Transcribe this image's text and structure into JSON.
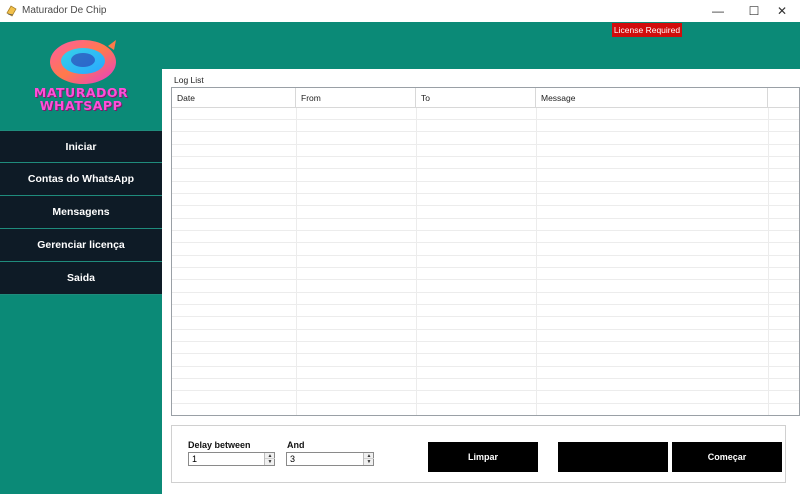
{
  "window": {
    "title": "Maturador De Chip",
    "minimize_glyph": "—",
    "maximize_glyph": "☐",
    "close_glyph": "✕"
  },
  "sidebar": {
    "logo_line1": "MATURADOR",
    "logo_line2": "WHATSAPP",
    "items": [
      {
        "label": "Iniciar"
      },
      {
        "label": "Contas do WhatsApp"
      },
      {
        "label": "Mensagens"
      },
      {
        "label": "Gerenciar licença"
      },
      {
        "label": "Saida"
      }
    ]
  },
  "header": {
    "license_badge": "License Required"
  },
  "log": {
    "label": "Log List",
    "columns": [
      "Date",
      "From",
      "To",
      "Message"
    ],
    "rows": []
  },
  "controls": {
    "delay_label": "Delay between",
    "delay_value": "1",
    "and_label": "And",
    "and_value": "3",
    "clear_button": "Limpar",
    "blank_button": "",
    "start_button": "Começar"
  },
  "colors": {
    "accent_teal": "#0b8a77",
    "nav_dark": "#0e1b26",
    "license_red": "#d10c0c",
    "button_black": "#000000"
  }
}
